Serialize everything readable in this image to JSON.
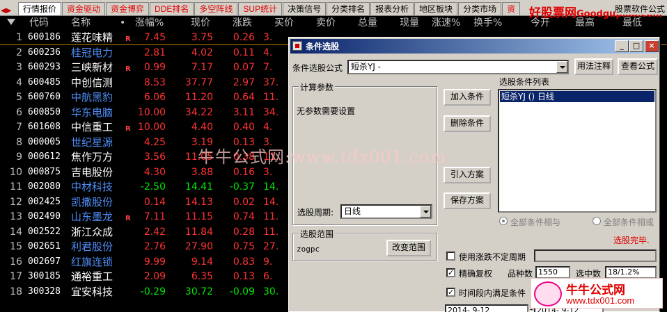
{
  "tabbar": {
    "nav_left": "◀",
    "nav_right": "▶",
    "tabs": [
      {
        "label": "行情报价",
        "color": "#000000",
        "active": true
      },
      {
        "label": "资金驱动",
        "color": "#e00000"
      },
      {
        "label": "资金博弈",
        "color": "#e00000"
      },
      {
        "label": "DDE排名",
        "color": "#e00000"
      },
      {
        "label": "多空阵线",
        "color": "#e00000"
      },
      {
        "label": "SUP统计",
        "color": "#e00000"
      },
      {
        "label": "决策信号",
        "color": "#000000"
      },
      {
        "label": "分类排名",
        "color": "#000000"
      },
      {
        "label": "报表分析",
        "color": "#000000"
      },
      {
        "label": "地区板块",
        "color": "#000000"
      },
      {
        "label": "分类市场",
        "color": "#000000"
      },
      {
        "label": "资",
        "color": "#e00000"
      }
    ],
    "brand": "好股票网",
    "brand_site": "Goodgupiao.com",
    "brand_right": "股票软件公式"
  },
  "table": {
    "headers": [
      "代码",
      "名称",
      "•",
      "涨幅%",
      "现价",
      "涨跌",
      "买价",
      "卖价",
      "总量",
      "现量",
      "涨速%",
      "换手%",
      "今开",
      "最高",
      "最低"
    ],
    "rows": [
      {
        "idx": "1",
        "code": "600186",
        "name": "莲花味精",
        "flag": "R",
        "pct": "7.45",
        "price": "3.75",
        "chg": "0.26",
        "buy": "3.",
        "name_color": "white",
        "dir": "red"
      },
      {
        "idx": "2",
        "code": "600236",
        "name": "桂冠电力",
        "flag": "",
        "pct": "2.81",
        "price": "4.02",
        "chg": "0.11",
        "buy": "4.",
        "name_color": "blue",
        "dir": "red"
      },
      {
        "idx": "3",
        "code": "600293",
        "name": "三峡新材",
        "flag": "R",
        "pct": "0.99",
        "price": "7.17",
        "chg": "0.07",
        "buy": "7.",
        "name_color": "white",
        "dir": "red"
      },
      {
        "idx": "4",
        "code": "600485",
        "name": "中创信测",
        "flag": "",
        "pct": "8.53",
        "price": "37.77",
        "chg": "2.97",
        "buy": "37.",
        "name_color": "white",
        "dir": "red"
      },
      {
        "idx": "5",
        "code": "600760",
        "name": "中航黑豹",
        "flag": "",
        "pct": "6.06",
        "price": "11.20",
        "chg": "0.64",
        "buy": "11.",
        "name_color": "blue",
        "dir": "red"
      },
      {
        "idx": "6",
        "code": "600850",
        "name": "华东电脑",
        "flag": "",
        "pct": "10.00",
        "price": "34.22",
        "chg": "3.11",
        "buy": "34.",
        "name_color": "blue",
        "dir": "red"
      },
      {
        "idx": "7",
        "code": "601608",
        "name": "中信重工",
        "flag": "R",
        "pct": "10.00",
        "price": "4.40",
        "chg": "0.40",
        "buy": "4.",
        "name_color": "white",
        "dir": "red"
      },
      {
        "idx": "8",
        "code": "000005",
        "name": "世纪星源",
        "flag": "",
        "pct": "4.25",
        "price": "3.19",
        "chg": "0.13",
        "buy": "3.",
        "name_color": "blue",
        "dir": "red"
      },
      {
        "idx": "9",
        "code": "000612",
        "name": "焦作万方",
        "flag": "",
        "pct": "3.56",
        "price": "11.05",
        "chg": "0.38",
        "buy": "11.",
        "name_color": "white",
        "dir": "red"
      },
      {
        "idx": "10",
        "code": "000875",
        "name": "吉电股份",
        "flag": "",
        "pct": "4.30",
        "price": "3.88",
        "chg": "0.16",
        "buy": "3.",
        "name_color": "white",
        "dir": "red"
      },
      {
        "idx": "11",
        "code": "002080",
        "name": "中材科技",
        "flag": "",
        "pct": "-2.50",
        "price": "14.41",
        "chg": "-0.37",
        "buy": "14.",
        "name_color": "blue",
        "dir": "green"
      },
      {
        "idx": "12",
        "code": "002425",
        "name": "凯撒股份",
        "flag": "",
        "pct": "0.14",
        "price": "14.13",
        "chg": "0.02",
        "buy": "14.",
        "name_color": "blue",
        "dir": "red"
      },
      {
        "idx": "13",
        "code": "002490",
        "name": "山东墨龙",
        "flag": "R",
        "pct": "7.11",
        "price": "11.15",
        "chg": "0.74",
        "buy": "11.",
        "name_color": "blue",
        "dir": "red"
      },
      {
        "idx": "14",
        "code": "002522",
        "name": "浙江众成",
        "flag": "",
        "pct": "2.42",
        "price": "11.84",
        "chg": "0.28",
        "buy": "11.",
        "name_color": "white",
        "dir": "red"
      },
      {
        "idx": "15",
        "code": "002651",
        "name": "利君股份",
        "flag": "",
        "pct": "2.76",
        "price": "27.90",
        "chg": "0.75",
        "buy": "27.",
        "name_color": "blue",
        "dir": "red"
      },
      {
        "idx": "16",
        "code": "002697",
        "name": "红旗连锁",
        "flag": "",
        "pct": "9.99",
        "price": "9.14",
        "chg": "0.83",
        "buy": "9.",
        "name_color": "blue",
        "dir": "red"
      },
      {
        "idx": "17",
        "code": "300185",
        "name": "通裕重工",
        "flag": "",
        "pct": "2.09",
        "price": "6.35",
        "chg": "0.13",
        "buy": "6.",
        "name_color": "white",
        "dir": "red"
      },
      {
        "idx": "18",
        "code": "300328",
        "name": "宜安科技",
        "flag": "",
        "pct": "-0.29",
        "price": "30.72",
        "chg": "-0.09",
        "buy": "30.",
        "name_color": "white",
        "dir": "green"
      }
    ]
  },
  "dialog": {
    "title": "条件选股",
    "formula_label": "条件选股公式",
    "formula_value": "短杀YJ   -",
    "usage_button": "用法注释",
    "view_formula_button": "查看公式",
    "params_group": "计算参数",
    "no_params": "无参数需要设置",
    "period_label": "选股周期:",
    "period_value": "日线",
    "add_condition": "加入条件",
    "delete_condition": "删除条件",
    "import_scheme": "引入方案",
    "save_scheme": "保存方案",
    "conditions_label": "选股条件列表",
    "conditions": [
      "短杀YJ  () 日线"
    ],
    "radio_and": "全部条件相与",
    "radio_or": "全部条件相或",
    "status": "选股完毕.",
    "range_group": "选股范围",
    "range_value": "zogpc",
    "change_range": "改变范围",
    "use_updown_period": "使用涨跌不定周期",
    "exact_restore": "精确复权",
    "variety_label": "品种数",
    "variety_value": "1550",
    "selected_label": "选中数",
    "selected_value": "18/1.2%",
    "time_condition": "时间段内满足条件",
    "date_from": "2014- 9-12",
    "date_to": "2014- 9-12",
    "minimize": "_",
    "maximize": "□",
    "close": "×"
  },
  "watermark": "牛牛公式网:www.tdx001.com",
  "stamp": {
    "title": "牛牛公式网",
    "url": "www.tdx001.com"
  }
}
